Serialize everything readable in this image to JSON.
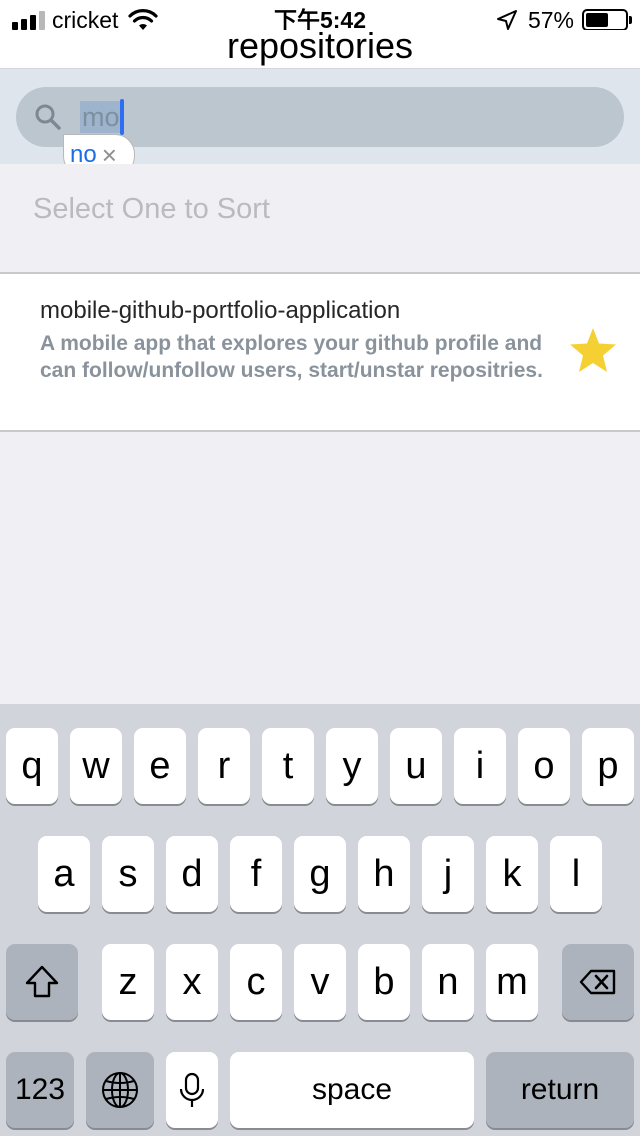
{
  "status_bar": {
    "carrier": "cricket",
    "time": "下午5:42",
    "battery_percent": "57%",
    "signal_bars_filled": 3,
    "signal_bars_total": 4,
    "battery_level": 0.57,
    "icons": [
      "signal-icon",
      "wifi-icon",
      "location-arrow-icon",
      "battery-icon"
    ]
  },
  "nav": {
    "title": "repositories"
  },
  "search": {
    "query": "mo",
    "query_selected": true,
    "autocorrect_suggestion": "no",
    "autocorrect_close": "×",
    "icon": "search-icon"
  },
  "sort": {
    "placeholder": "Select One to Sort"
  },
  "repositories": [
    {
      "name": "mobile-github-portfolio-application",
      "description": "A mobile app that explores your github profile and can follow/unfollow users, start/unstar repositries.",
      "starred": true,
      "icon": "star-icon"
    }
  ],
  "keyboard": {
    "row1": [
      "q",
      "w",
      "e",
      "r",
      "t",
      "y",
      "u",
      "i",
      "o",
      "p"
    ],
    "row2": [
      "a",
      "s",
      "d",
      "f",
      "g",
      "h",
      "j",
      "k",
      "l"
    ],
    "row3": [
      "z",
      "x",
      "c",
      "v",
      "b",
      "n",
      "m"
    ],
    "numbers_label": "123",
    "space_label": "space",
    "return_label": "return",
    "icons": [
      "shift-icon",
      "backspace-icon",
      "globe-icon",
      "microphone-icon"
    ]
  },
  "colors": {
    "accent_blue": "#2f6ef2",
    "star_yellow": "#f5d033",
    "search_bg": "#dfe5ec"
  }
}
